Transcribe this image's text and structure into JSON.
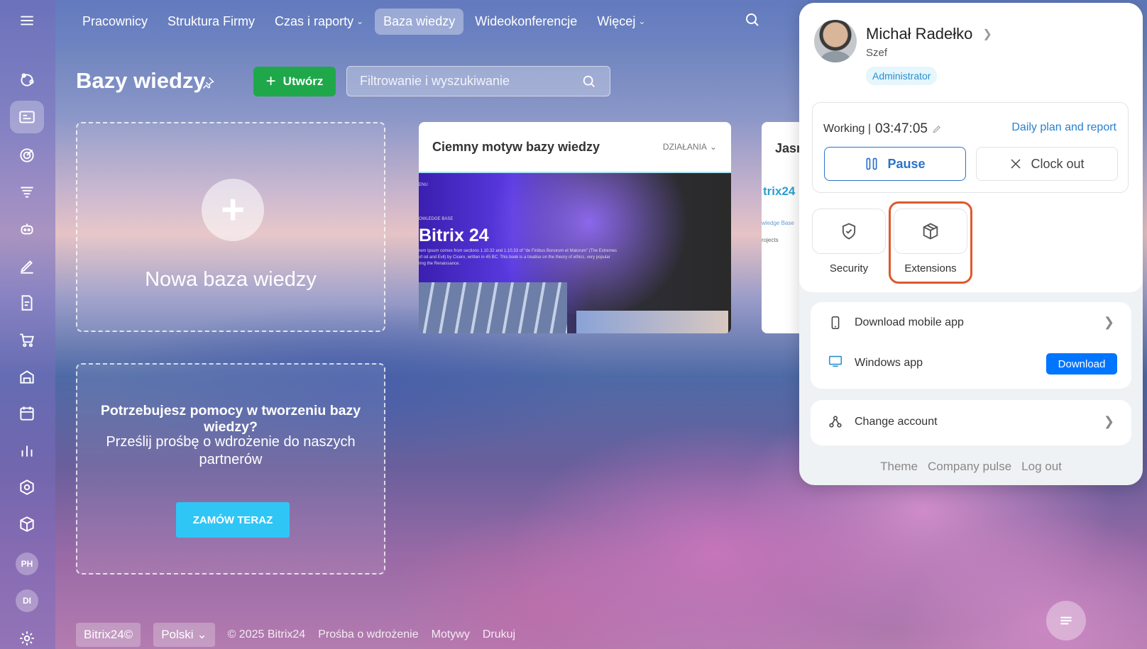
{
  "sidebar": {
    "items": [
      "menu-icon",
      "activity-icon",
      "knowledge-icon",
      "target-icon",
      "filter-icon",
      "robot-icon",
      "pen-icon",
      "document-icon",
      "cart-icon",
      "warehouse-icon",
      "calendar-icon",
      "chart-icon",
      "hexagon-icon",
      "box-icon"
    ],
    "avatars": [
      "PH",
      "DI"
    ]
  },
  "nav": {
    "items": [
      {
        "label": "Pracownicy"
      },
      {
        "label": "Struktura Firmy"
      },
      {
        "label": "Czas i raporty"
      },
      {
        "label": "Baza wiedzy"
      },
      {
        "label": "Wideokonferencje"
      },
      {
        "label": "Więcej"
      }
    ]
  },
  "page": {
    "title": "Bazy wiedzy",
    "create_label": "Utwórz",
    "filter_placeholder": "Filtrowanie i wyszukiwanie"
  },
  "new_card": {
    "label": "Nowa baza wiedzy"
  },
  "help_card": {
    "heading": "Potrzebujesz pomocy w tworzeniu bazy wiedzy?",
    "text": "Prześlij prośbę o wdrożenie do naszych partnerów",
    "button": "ZAMÓW TERAZ"
  },
  "kb_cards": [
    {
      "name": "Ciemny motyw bazy wiedzy",
      "actions": "DZIAŁANIA",
      "preview_menu": "ENU",
      "preview_kicker": "OWLEDGE BASE",
      "preview_title": "Bitrix 24",
      "preview_body": "rem Ipsum comes from sections 1.10.32 and 1.10.33 of \"de Finibus Bonorum et Malorum\" (The Extremes of od and Evil) by Cicero, written in 45 BC. This book is a treatise on the theory of ethics, very popular ring the Renaissance."
    },
    {
      "name": "Jasn",
      "preview_logo": "trix24",
      "preview_sub": "wledge Base",
      "preview_sub2": "rojects"
    }
  ],
  "footer": {
    "brand": "Bitrix24©",
    "language": "Polski",
    "copyright": "© 2025 Bitrix24",
    "links": [
      "Prośba o wdrożenie",
      "Motywy",
      "Drukuj"
    ]
  },
  "profile": {
    "name": "Michał Radełko",
    "role": "Szef",
    "badge": "Administrator",
    "work_status": "Working |",
    "work_time": "03:47:05",
    "plan_link": "Daily plan and report",
    "pause_label": "Pause",
    "clockout_label": "Clock out",
    "tiles": [
      {
        "label": "Security",
        "icon": "shield-icon"
      },
      {
        "label": "Extensions",
        "icon": "package-icon"
      }
    ],
    "mobile_app": "Download mobile app",
    "windows_app": "Windows app",
    "download_label": "Download",
    "change_account": "Change account",
    "bottom_links": [
      "Theme",
      "Company pulse",
      "Log out"
    ]
  }
}
